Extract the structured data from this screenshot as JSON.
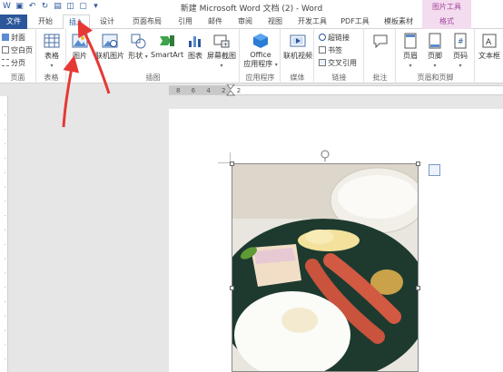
{
  "window": {
    "title": "新建 Microsoft Word 文档 (2) - Word",
    "contextual_header": "图片工具"
  },
  "tabs": [
    {
      "label": "文件"
    },
    {
      "label": "开始"
    },
    {
      "label": "插入"
    },
    {
      "label": "设计"
    },
    {
      "label": "页面布局"
    },
    {
      "label": "引用"
    },
    {
      "label": "邮件"
    },
    {
      "label": "审阅"
    },
    {
      "label": "视图"
    },
    {
      "label": "开发工具"
    },
    {
      "label": "PDF工具"
    },
    {
      "label": "模板素材"
    },
    {
      "label": "格式"
    }
  ],
  "ribbon": {
    "pages": {
      "label": "页面",
      "items": [
        "封面",
        "空白页",
        "分页"
      ]
    },
    "tables": {
      "label": "表格",
      "table_btn": "表格"
    },
    "illustrations": {
      "label": "插图",
      "picture": "图片",
      "online_picture": "联机图片",
      "shapes": "形状",
      "smartart": "SmartArt",
      "chart": "图表",
      "screenshot": "屏幕截图"
    },
    "apps": {
      "label": "应用程序",
      "office_line1": "Office",
      "office_line2": "应用程序"
    },
    "media": {
      "label": "媒体",
      "online_video": "联机视频"
    },
    "links": {
      "label": "链接",
      "hyperlink": "超链接",
      "bookmark": "书签",
      "cross_ref": "交叉引用"
    },
    "comments": {
      "label": "批注",
      "comment": "批注"
    },
    "header_footer": {
      "label": "页眉和页脚",
      "header": "页眉",
      "footer": "页脚",
      "page_number": "页码"
    },
    "text": {
      "textbox": "文本框"
    }
  },
  "ruler": {
    "h_numbers": "8 6 4 2   2"
  },
  "colors": {
    "word_blue": "#2b579a",
    "annotation_red": "#e53935",
    "context_pink": "#a14598"
  }
}
